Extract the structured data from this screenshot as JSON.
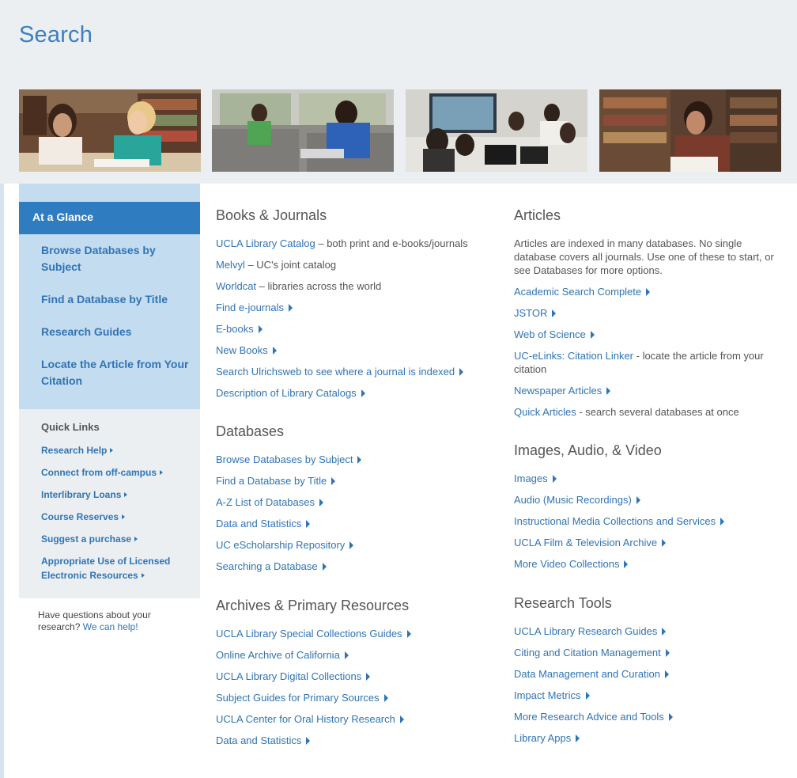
{
  "page": {
    "title": "Search"
  },
  "photos": [
    "photo-students-studying",
    "photo-students-lounge-laptop",
    "photo-group-screen-meeting",
    "photo-student-in-stacks"
  ],
  "sidebar": {
    "active": "At a Glance",
    "links": [
      "Browse Databases by Subject",
      "Find a Database by Title",
      "Research Guides",
      "Locate the Article from Your Citation"
    ],
    "quick_links_heading": "Quick Links",
    "quick_links": [
      "Research Help",
      "Connect from off-campus",
      "Interlibrary Loans",
      "Course Reserves",
      "Suggest a purchase",
      "Appropriate Use of Licensed Electronic Resources"
    ],
    "help_text": "Have questions about your research?",
    "help_link": "We can help!"
  },
  "books": {
    "title": "Books & Journals",
    "items": [
      {
        "label": "UCLA Library Catalog",
        "desc": " – both print and e-books/journals"
      },
      {
        "label": "Melvyl",
        "desc": " – UC's joint catalog"
      },
      {
        "label": "Worldcat",
        "desc": " – libraries across the world"
      },
      {
        "label": "Find e-journals"
      },
      {
        "label": "E-books"
      },
      {
        "label": "New Books"
      },
      {
        "label": "Search Ulrichsweb to see where a journal is indexed"
      },
      {
        "label": "Description of Library Catalogs"
      }
    ]
  },
  "databases": {
    "title": "Databases",
    "items": [
      "Browse Databases by Subject",
      "Find a Database by Title",
      "A-Z List of Databases",
      "Data and Statistics",
      "UC eScholarship Repository",
      "Searching a Database"
    ]
  },
  "archives": {
    "title": "Archives & Primary Resources",
    "items": [
      "UCLA Library Special Collections Guides",
      "Online Archive of California",
      "UCLA Library Digital Collections",
      "Subject Guides for Primary Sources",
      "UCLA Center for Oral History Research",
      "Data and Statistics"
    ]
  },
  "articles": {
    "title": "Articles",
    "intro": "Articles are indexed in many databases. No single database covers all journals. Use one of these to start, or see Databases for more options.",
    "items": [
      {
        "label": "Academic Search Complete"
      },
      {
        "label": "JSTOR"
      },
      {
        "label": "Web of Science"
      },
      {
        "label": "UC-eLinks: Citation Linker",
        "desc": " - locate the article from your citation"
      },
      {
        "label": "Newspaper Articles"
      },
      {
        "label": "Quick Articles",
        "desc": " - search several databases at once"
      }
    ]
  },
  "images": {
    "title": "Images, Audio, & Video",
    "items": [
      "Images",
      "Audio (Music Recordings)",
      "Instructional Media Collections and Services",
      "UCLA Film & Television Archive",
      "More Video Collections"
    ]
  },
  "tools": {
    "title": "Research Tools",
    "items": [
      "UCLA Library Research Guides",
      "Citing and Citation Management",
      "Data Management and Curation",
      "Impact Metrics",
      "More Research Advice and Tools",
      "Library Apps"
    ]
  }
}
